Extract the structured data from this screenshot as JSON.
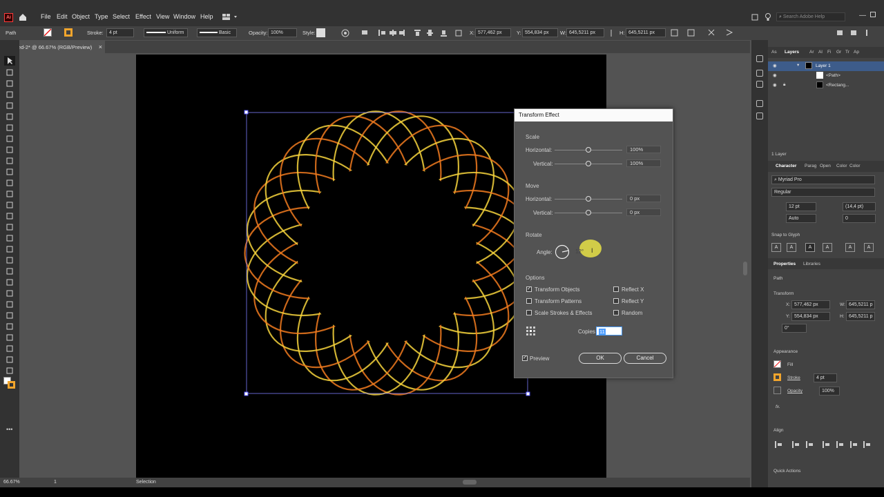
{
  "app": {
    "menu": [
      "File",
      "Edit",
      "Object",
      "Type",
      "Select",
      "Effect",
      "View",
      "Window",
      "Help"
    ],
    "search_placeholder": "Search Adobe Help"
  },
  "control": {
    "selection_type": "Path",
    "stroke_label": "Stroke:",
    "stroke_weight": "4 pt",
    "profile": "Uniform",
    "brush": "Basic",
    "opacity_label": "Opacity:",
    "opacity": "100%",
    "style_label": "Style:",
    "x_label": "X:",
    "x": "577,462 px",
    "y_label": "Y:",
    "y": "554,834 px",
    "w_label": "W:",
    "w": "645,5211 px",
    "h_label": "H:",
    "h": "645,5211 px"
  },
  "document": {
    "tab_title": "ed-2* @ 66.67% (RGB/Preview)",
    "zoom": "66.67%",
    "artboard": "1",
    "status": "Selection"
  },
  "dialog": {
    "title": "Transform Effect",
    "scale": {
      "label": "Scale",
      "horizontal_label": "Horizontal:",
      "horizontal": "100%",
      "vertical_label": "Vertical:",
      "vertical": "100%"
    },
    "move": {
      "label": "Move",
      "horizontal_label": "Horizontal:",
      "horizontal": "0 px",
      "vertical_label": "Vertical:",
      "vertical": "0 px"
    },
    "rotate": {
      "label": "Rotate",
      "angle_label": "Angle:",
      "angle": "12°"
    },
    "options": {
      "label": "Options",
      "transform_objects": "Transform Objects",
      "transform_patterns": "Transform Patterns",
      "scale_strokes": "Scale Strokes & Effects",
      "reflect_x": "Reflect X",
      "reflect_y": "Reflect Y",
      "random": "Random"
    },
    "copies_label": "Copies",
    "copies": "11",
    "preview_label": "Preview",
    "ok": "OK",
    "cancel": "Cancel"
  },
  "layers": {
    "tabs": [
      "As",
      "Layers",
      "Ar",
      "Al",
      "Fi",
      "Gr",
      "Tr",
      "Ap"
    ],
    "items": [
      "Layer 1",
      "<Path>",
      "<Rectang..."
    ],
    "count": "1 Layer"
  },
  "character": {
    "tabs": [
      "Character",
      "Parag",
      "Open",
      "Color",
      "Color"
    ],
    "font": "Myriad Pro",
    "style": "Regular",
    "size": "12 pt",
    "leading": "(14,4 pt)",
    "tracking": "Auto",
    "kerning": "0",
    "snap_label": "Snap to Glyph"
  },
  "properties": {
    "tabs": [
      "Properties",
      "Libraries"
    ],
    "kind": "Path",
    "transform_label": "Transform",
    "x_label": "X:",
    "x": "577,462 px",
    "y_label": "Y:",
    "y": "554,834 px",
    "w_label": "W:",
    "w": "645,5211 p",
    "h_label": "H:",
    "h": "645,5211 p",
    "angle": "0°",
    "appearance_label": "Appearance",
    "fill_label": "Fill",
    "stroke_label": "Stroke",
    "stroke_weight": "4 pt",
    "opacity_label": "Opacity",
    "opacity": "100%",
    "fx_label": "fx.",
    "align_label": "Align",
    "quick_actions_label": "Quick Actions"
  },
  "colors": {
    "accent": "#4b9cff",
    "stroke_swatch": "#f2a52c",
    "ring_inner": "#f5d23c",
    "ring_outer": "#f07a1e"
  }
}
